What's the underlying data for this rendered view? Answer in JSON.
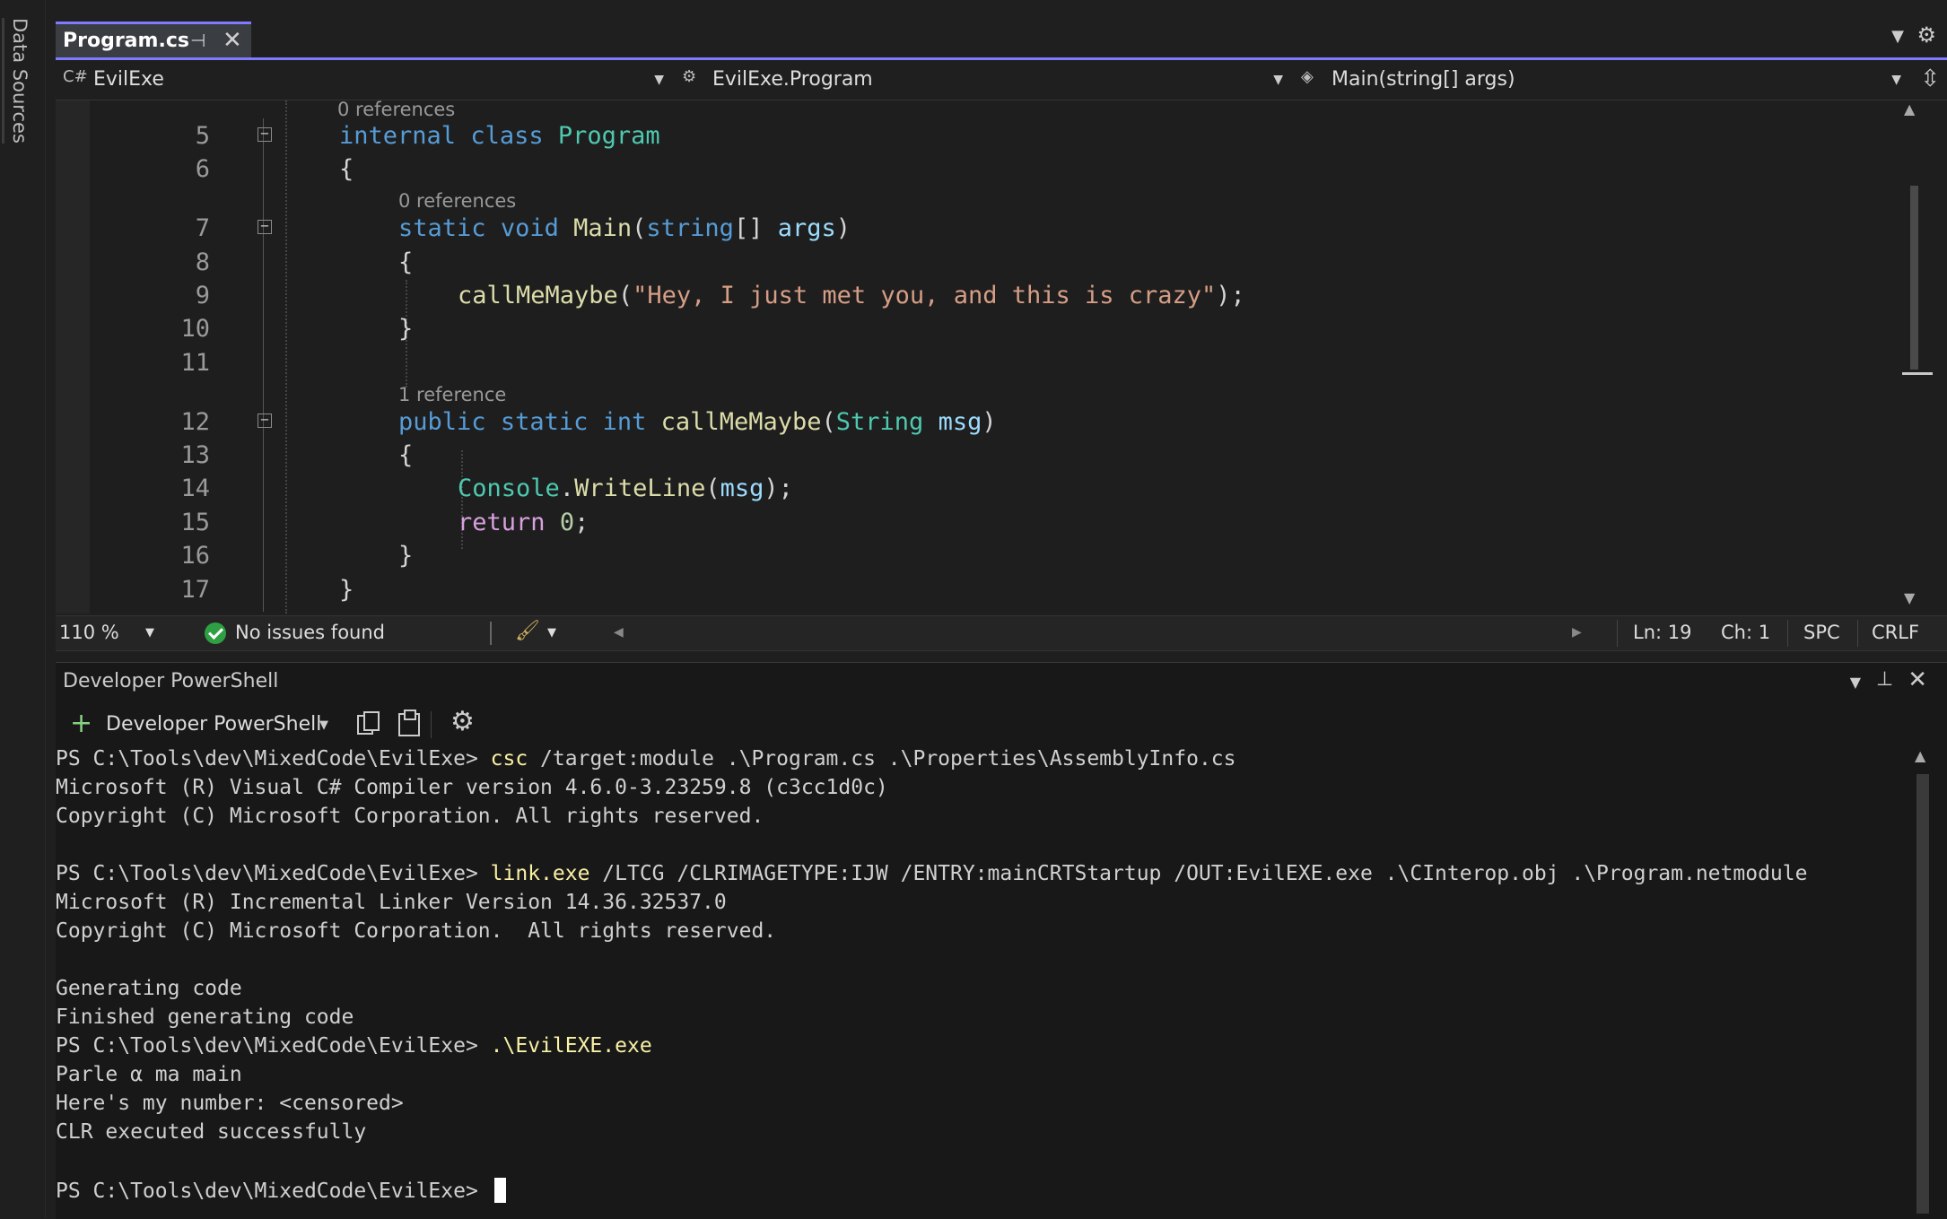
{
  "rail": {
    "label": "Data Sources"
  },
  "tab": {
    "title": "Program.cs",
    "pin": "⊣",
    "close": "✕"
  },
  "nav": {
    "project": "EvilExe",
    "class": "EvilExe.Program",
    "member": "Main(string[] args)"
  },
  "code": {
    "lens_0": "0 references",
    "lens_main": "0 references",
    "lens_call": "1 reference",
    "lines": [
      {
        "num": "5"
      },
      {
        "num": "6"
      },
      {
        "num": "7"
      },
      {
        "num": "8"
      },
      {
        "num": "9"
      },
      {
        "num": "10"
      },
      {
        "num": "11"
      },
      {
        "num": "12"
      },
      {
        "num": "13"
      },
      {
        "num": "14"
      },
      {
        "num": "15"
      },
      {
        "num": "16"
      },
      {
        "num": "17"
      }
    ],
    "tok": {
      "internal": "internal",
      "class": "class",
      "program": "Program",
      "brace_open": "{",
      "brace_close": "}",
      "static": "static",
      "void": "void",
      "main": "Main",
      "paren_open": "(",
      "string": "string",
      "brackets": "[]",
      "args": "args",
      "paren_close": ")",
      "callmemaybe": "callMeMaybe",
      "str_lit": "\"Hey, I just met you, and this is crazy\"",
      "end_call": ");",
      "public": "public",
      "int": "int",
      "String": "String",
      "msg": "msg",
      "console": "Console",
      "dot": ".",
      "writeline": "WriteLine",
      "semicolon": ";",
      "return": "return",
      "zero": "0"
    }
  },
  "status": {
    "zoom": "110 %",
    "issues": "No issues found",
    "ln": "Ln: 19",
    "ch": "Ch: 1",
    "spc": "SPC",
    "crlf": "CRLF"
  },
  "terminal": {
    "title": "Developer PowerShell",
    "profile": "Developer PowerShell",
    "prompt": "PS C:\\Tools\\dev\\MixedCode\\EvilExe> ",
    "lines": {
      "cmd1_name": "csc",
      "cmd1_args": " /target:module .\\Program.cs .\\Properties\\AssemblyInfo.cs",
      "out1": "Microsoft (R) Visual C# Compiler version 4.6.0-3.23259.8 (c3cc1d0c)",
      "out2": "Copyright (C) Microsoft Corporation. All rights reserved.",
      "cmd2_name": "link.exe",
      "cmd2_args": " /LTCG /CLRIMAGETYPE:IJW /ENTRY:mainCRTStartup /OUT:EvilEXE.exe .\\CInterop.obj .\\Program.netmodule",
      "out3": "Microsoft (R) Incremental Linker Version 14.36.32537.0",
      "out4": "Copyright (C) Microsoft Corporation.  All rights reserved.",
      "out5": "Generating code",
      "out6": "Finished generating code",
      "cmd3_name": ".\\EvilEXE.exe",
      "out7": "Parle α ma main",
      "out8": "Here's my number: <censored>",
      "out9": "CLR executed successfully"
    }
  },
  "colors": {
    "accent": "#7f7aff",
    "keyword": "#569cd6",
    "type": "#4ec9b0",
    "method": "#dcdcaa",
    "string": "#d69d85",
    "control": "#d8a0df",
    "success": "#2ea043",
    "command": "#f9f1a5"
  },
  "icons": [
    "csharp-project-icon",
    "class-icon",
    "method-icon",
    "pin-icon",
    "close-icon",
    "gear-icon",
    "check-circle-icon",
    "brush-icon",
    "plus-icon",
    "copy-icon",
    "paste-icon"
  ]
}
